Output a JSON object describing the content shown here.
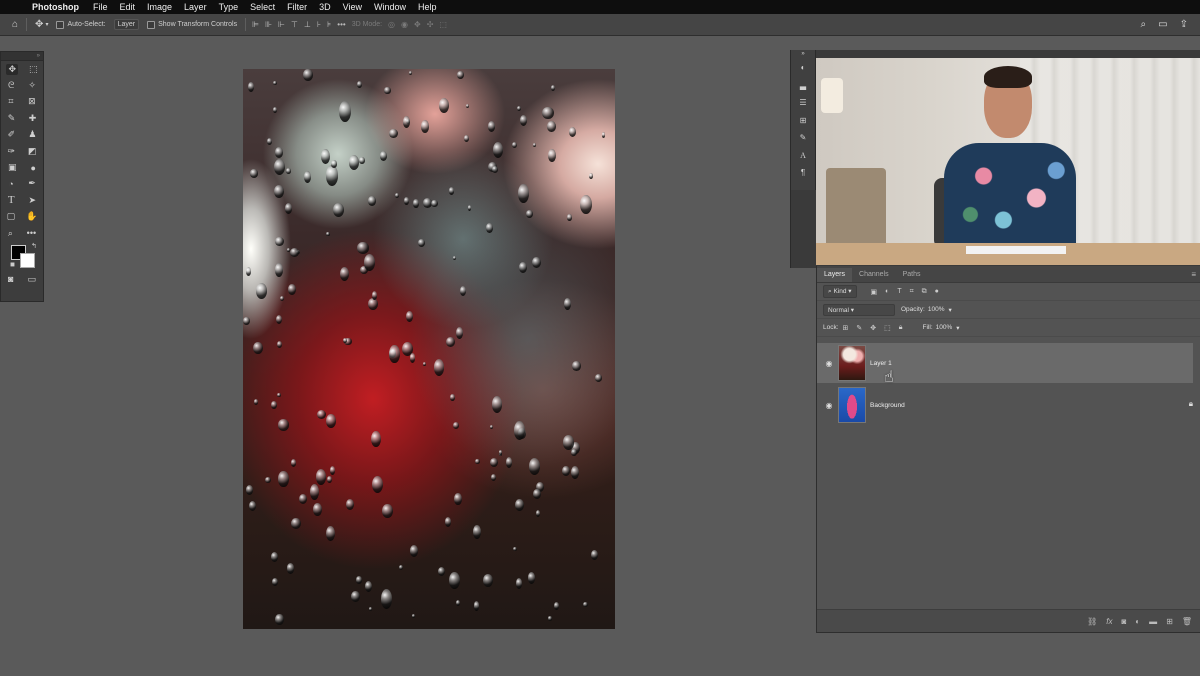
{
  "menubar": {
    "app_name": "Photoshop",
    "items": [
      "File",
      "Edit",
      "Image",
      "Layer",
      "Type",
      "Select",
      "Filter",
      "3D",
      "View",
      "Window",
      "Help"
    ]
  },
  "options_bar": {
    "auto_select_label": "Auto-Select:",
    "auto_select_value": "Layer",
    "show_transform_label": "Show Transform Controls",
    "mode_3d_label": "3D Mode:"
  },
  "layers_panel": {
    "tabs": [
      "Layers",
      "Channels",
      "Paths"
    ],
    "filter_value": "Kind",
    "blend_mode": "Normal",
    "opacity_label": "Opacity:",
    "opacity_value": "100%",
    "lock_label": "Lock:",
    "fill_label": "Fill:",
    "fill_value": "100%",
    "layers": [
      {
        "name": "Layer 1",
        "selected": true
      },
      {
        "name": "Background",
        "selected": false,
        "locked": true
      }
    ]
  }
}
